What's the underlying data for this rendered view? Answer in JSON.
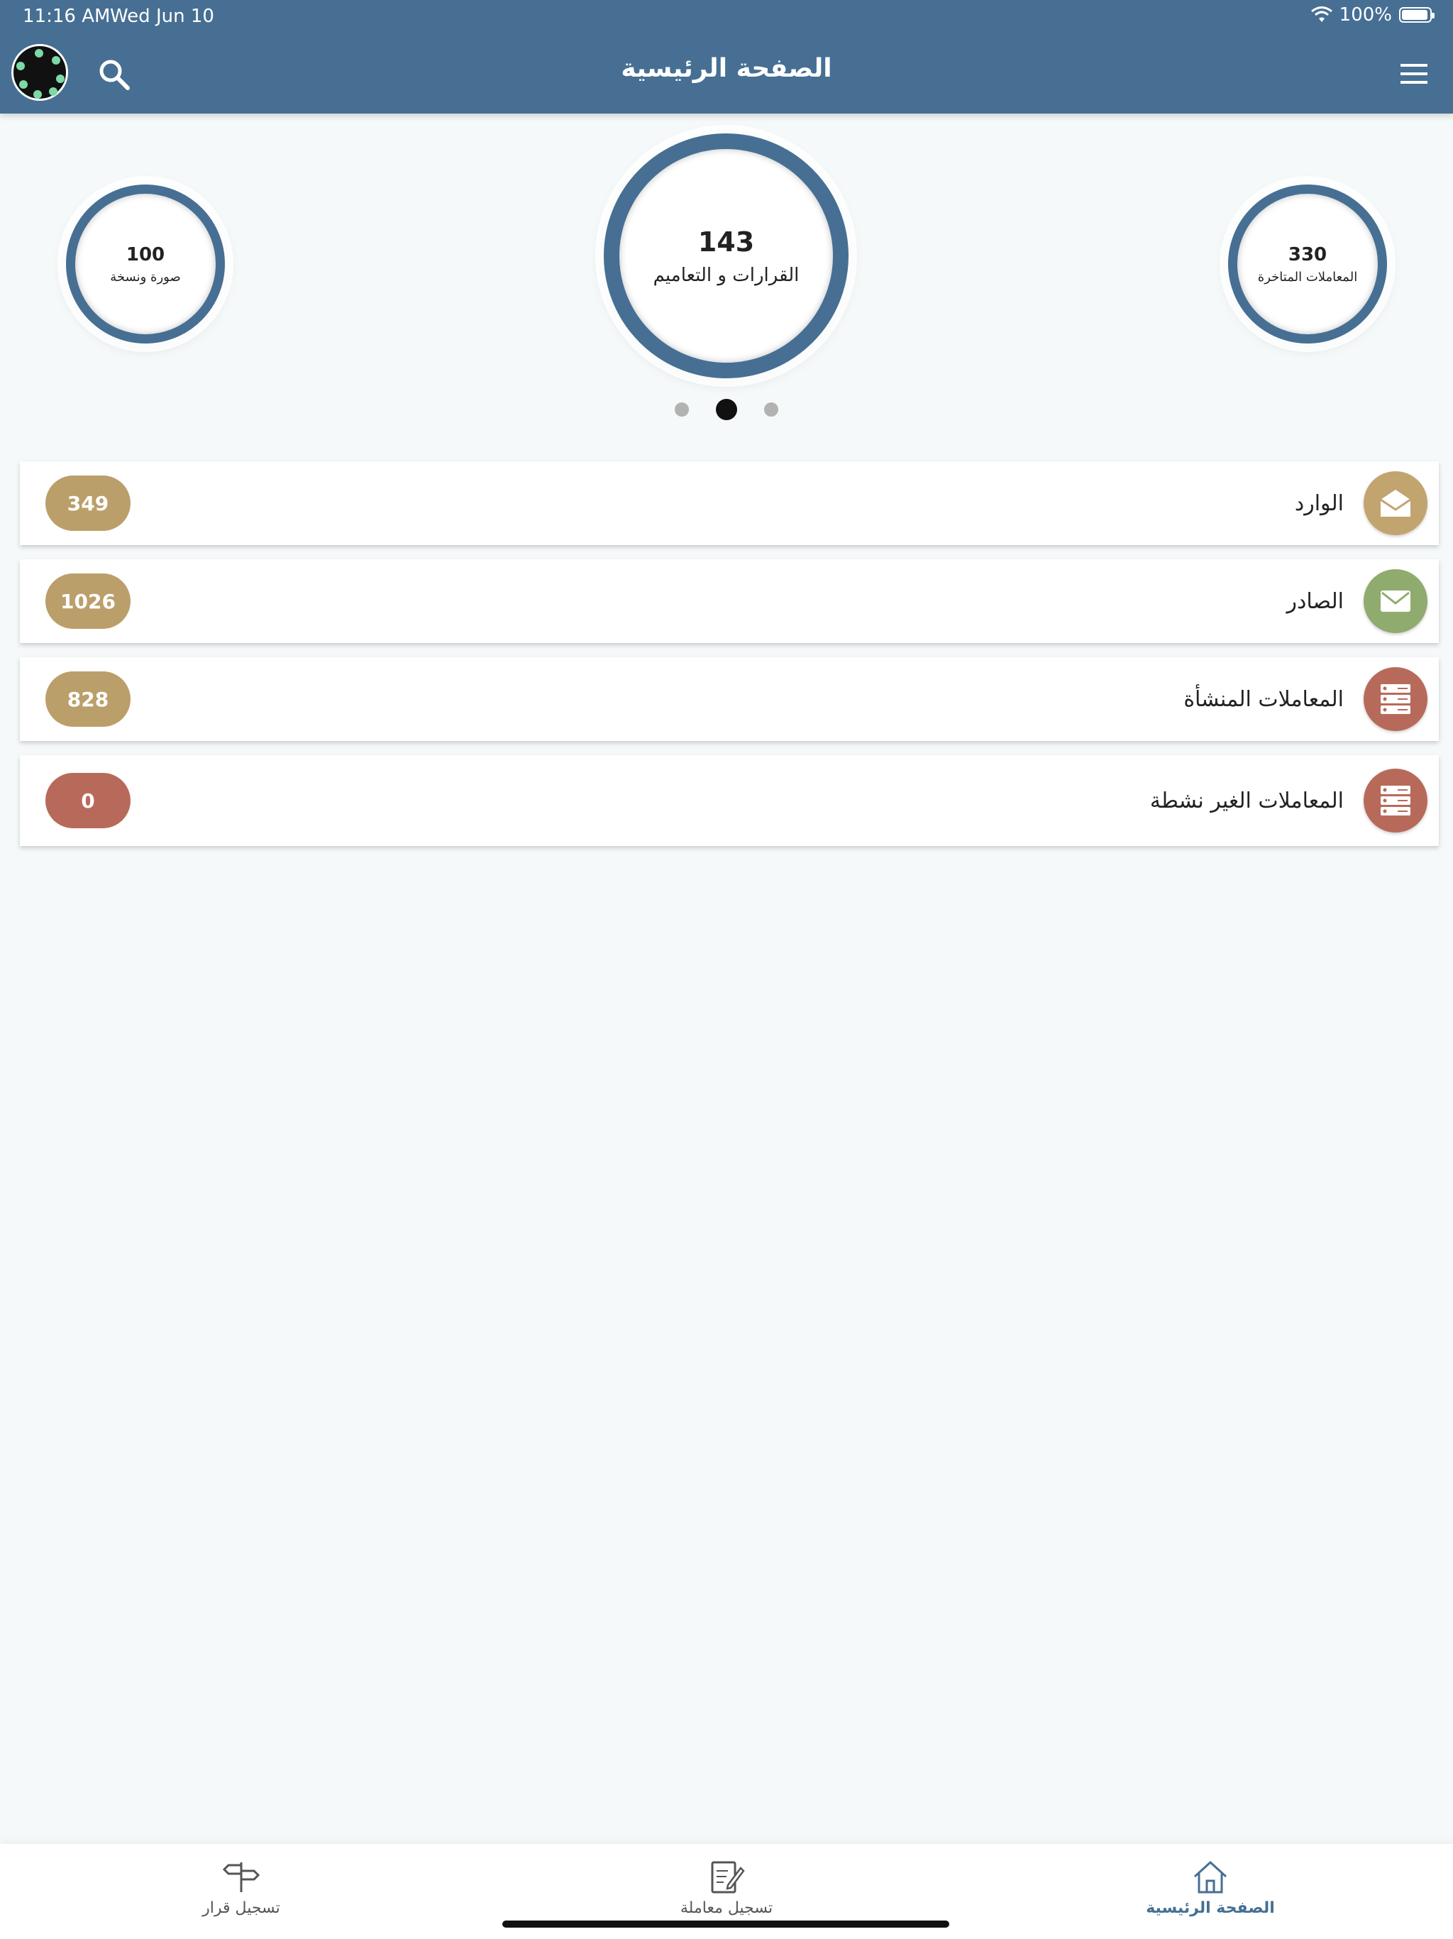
{
  "status_bar": {
    "time": "11:16 AM",
    "date": "Wed Jun 10",
    "battery": "100%"
  },
  "header": {
    "title": "الصفحة الرئيسية"
  },
  "stats": {
    "left": {
      "value": "100",
      "label": "صورة ونسخة"
    },
    "center": {
      "value": "143",
      "label": "القرارات و التعاميم"
    },
    "right": {
      "value": "330",
      "label": "المعاملات المتاخرة"
    }
  },
  "pager": {
    "count": 3,
    "active_index": 1
  },
  "list": [
    {
      "label": "الوارد",
      "count": "349",
      "icon": "envelope-open-icon",
      "icon_color": "#c2a46f",
      "badge_color": "#bb9f6a"
    },
    {
      "label": "الصادر",
      "count": "1026",
      "icon": "envelope-icon",
      "icon_color": "#8fab6e",
      "badge_color": "#bb9f6a"
    },
    {
      "label": "المعاملات المنشأة",
      "count": "828",
      "icon": "server-icon",
      "icon_color": "#b86a5a",
      "badge_color": "#bb9f6a"
    },
    {
      "label": "المعاملات الغير نشطة",
      "count": "0",
      "icon": "server-icon",
      "icon_color": "#b86a5a",
      "badge_color": "#b86a5a"
    }
  ],
  "tabs": [
    {
      "label": "الصفحة الرئيسية",
      "icon": "home-icon",
      "active": true
    },
    {
      "label": "تسجيل معاملة",
      "icon": "edit-document-icon",
      "active": false
    },
    {
      "label": "تسجيل قرار",
      "icon": "signpost-icon",
      "active": false
    }
  ],
  "colors": {
    "header": "#466f93",
    "ring": "#466f93"
  }
}
